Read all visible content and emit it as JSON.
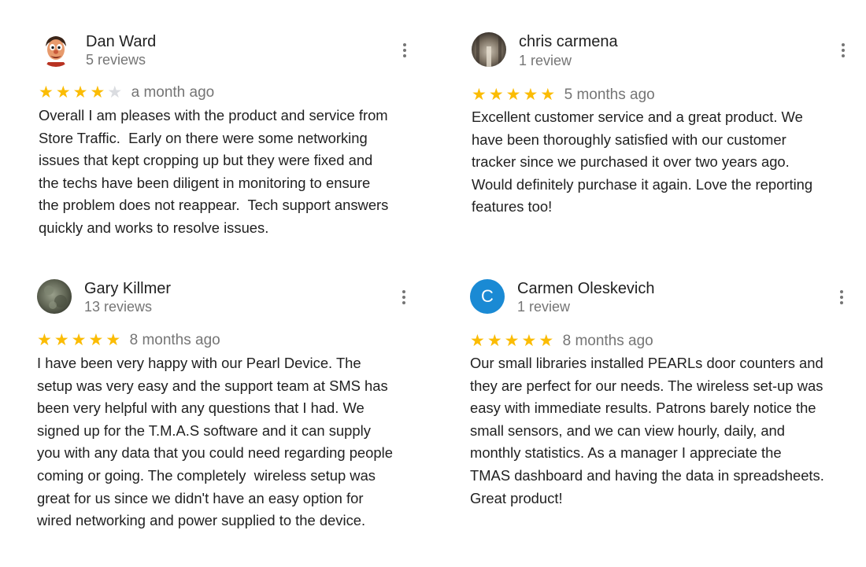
{
  "colors": {
    "star_filled": "#fbbc04",
    "star_empty": "#dadce0",
    "secondary_text": "#757575",
    "avatar_letter_bg": "#1a8ad4"
  },
  "reviews": [
    {
      "author": "Dan Ward",
      "review_count": "5 reviews",
      "avatar_icon": "cartoon-avatar-icon",
      "rating": 4,
      "date": "a month ago",
      "lines": [
        "Overall I am pleases with the product and service from",
        "Store Traffic.  Early on there were some networking",
        "issues that kept cropping up but they were fixed and",
        "the techs have been diligent in monitoring to ensure",
        "the problem does not reappear.  Tech support answers",
        "quickly and works to resolve issues."
      ]
    },
    {
      "author": "chris carmena",
      "review_count": "1 review",
      "avatar_icon": "photo-avatar-icon",
      "rating": 5,
      "date": "5 months ago",
      "lines": [
        "Excellent customer service and a great product. We",
        "have been thoroughly satisfied with our customer",
        "tracker since we purchased it over two years ago.",
        "Would definitely purchase it again. Love the reporting",
        "features too!"
      ]
    },
    {
      "author": "Gary Killmer",
      "review_count": "13 reviews",
      "avatar_icon": "photo-avatar-icon",
      "rating": 5,
      "date": "8 months ago",
      "lines": [
        "I have been very happy with our Pearl Device. The",
        "setup was very easy and the support team at SMS has",
        "been very helpful with any questions that I had. We",
        "signed up for the T.M.A.S software and it can supply",
        "you with any data that you could need regarding people",
        "coming or going. The completely  wireless setup was",
        "great for us since we didn't have an easy option for",
        "wired networking and power supplied to the device."
      ]
    },
    {
      "author": "Carmen Oleskevich",
      "review_count": "1 review",
      "avatar_letter": "C",
      "rating": 5,
      "date": "8 months ago",
      "lines": [
        "Our small libraries installed PEARLs door counters and",
        "they are perfect for our needs. The wireless set-up was",
        "easy with immediate results. Patrons barely notice the",
        "small sensors, and we can view hourly, daily, and",
        "monthly statistics. As a manager I appreciate the",
        "TMAS dashboard and having the data in spreadsheets.",
        "Great product!"
      ]
    }
  ]
}
